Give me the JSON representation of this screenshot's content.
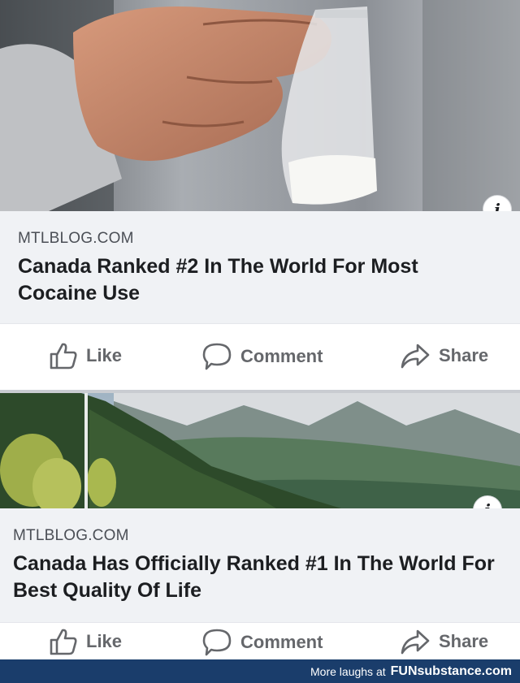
{
  "posts": [
    {
      "domain": "MTLBLOG.COM",
      "headline": "Canada Ranked #2 In The World For Most Cocaine Use",
      "info_icon": "i",
      "image": "hand holding small bag of white powder"
    },
    {
      "domain": "MTLBLOG.COM",
      "headline": "Canada Has Officially Ranked #1 In The World For Best Quality Of Life",
      "info_icon": "i",
      "image": "forest and mountain landscape"
    }
  ],
  "actions": {
    "like": "Like",
    "comment": "Comment",
    "share": "Share"
  },
  "footer": {
    "text": "More laughs at",
    "brand": "FUNsubstance.com"
  },
  "colors": {
    "meta_background": "#f0f2f5",
    "action_text": "#65676b",
    "footer_background": "#1a3d6b"
  }
}
